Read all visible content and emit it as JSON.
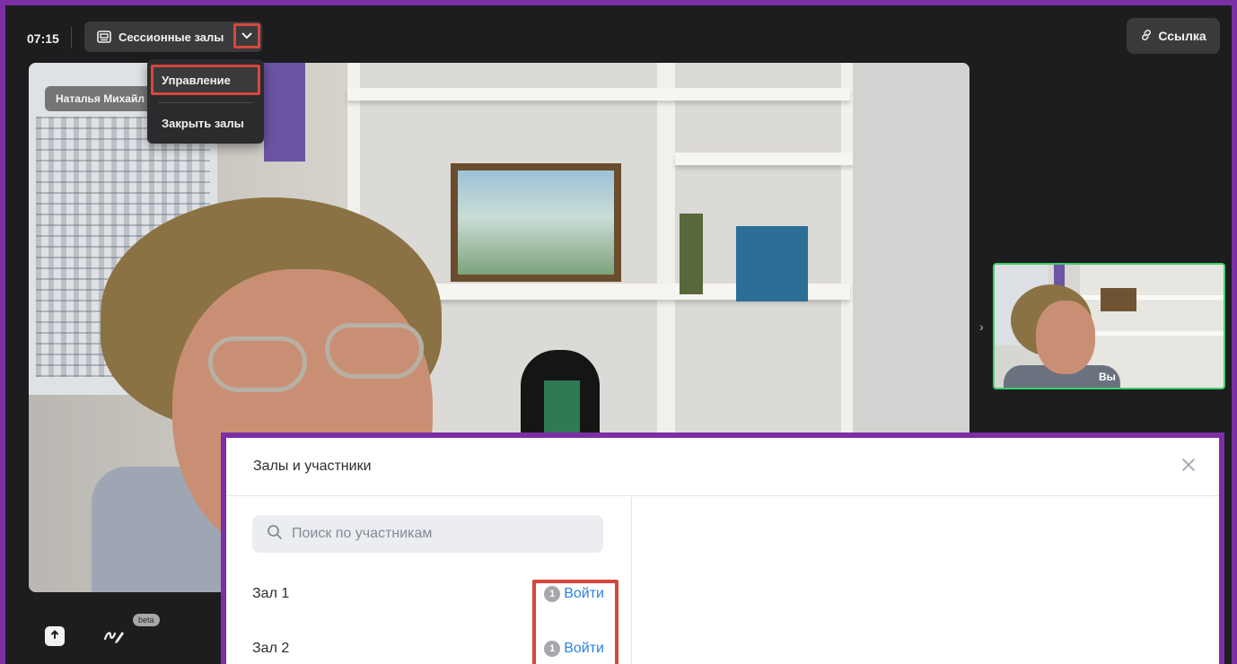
{
  "toolbar": {
    "timer": "07:15",
    "sessions_label": "Сессионные залы",
    "link_label": "Ссылка"
  },
  "dropdown": {
    "manage_label": "Управление",
    "close_rooms_label": "Закрыть залы"
  },
  "main_video": {
    "participant_name": "Наталья Михайл"
  },
  "self_view": {
    "label": "Вы"
  },
  "bottom": {
    "beta_label": "beta"
  },
  "modal": {
    "title": "Залы и участники",
    "search_placeholder": "Поиск по участникам",
    "rooms": [
      {
        "name": "Зал 1",
        "count": "1",
        "action": "Войти"
      },
      {
        "name": "Зал 2",
        "count": "1",
        "action": "Войти"
      }
    ]
  },
  "colors": {
    "frame_purple": "#7b2fa5",
    "highlight_red": "#d5483b",
    "self_border_green": "#3cd06a",
    "link_blue": "#2d81e0",
    "background_dark": "#1d1d1f"
  },
  "icons": [
    "rooms-icon",
    "chevron-down-icon",
    "link-icon",
    "chevron-right-icon",
    "upload-icon",
    "draw-icon",
    "close-icon",
    "search-icon"
  ]
}
